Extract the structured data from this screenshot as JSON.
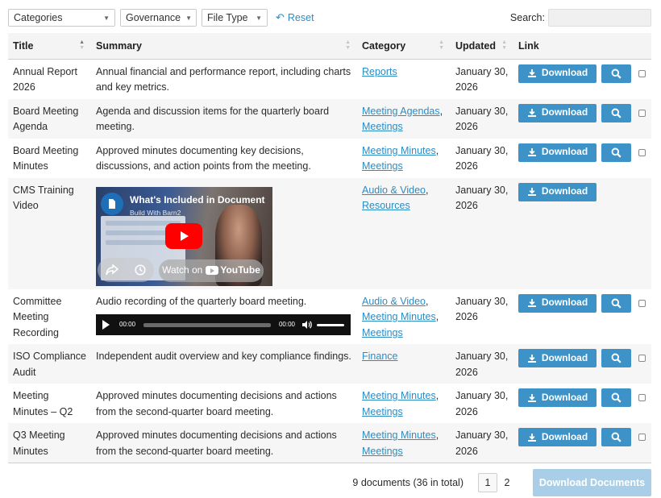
{
  "filters": {
    "categories": "Categories",
    "governance": "Governance",
    "file_type": "File Type",
    "reset": "Reset",
    "search_label": "Search:",
    "search_value": ""
  },
  "table": {
    "headers": {
      "title": "Title",
      "summary": "Summary",
      "category": "Category",
      "updated": "Updated",
      "link": "Link"
    },
    "download_label": "Download",
    "rows": [
      {
        "title": "Annual Report 2026",
        "summary": "Annual financial and performance report, including charts and key metrics.",
        "categories": [
          "Reports"
        ],
        "updated": "January 30, 2026"
      },
      {
        "title": "Board Meeting Agenda",
        "summary": "Agenda and discussion items for the quarterly board meeting.",
        "categories": [
          "Meeting Agendas",
          "Meetings"
        ],
        "updated": "January 30, 2026"
      },
      {
        "title": "Board Meeting Minutes",
        "summary": "Approved minutes documenting key decisions, discussions, and action points from the meeting.",
        "categories": [
          "Meeting Minutes",
          "Meetings"
        ],
        "updated": "January 30, 2026"
      },
      {
        "title": "CMS Training Video",
        "summary": "",
        "categories": [
          "Audio & Video",
          "Resources"
        ],
        "updated": "January 30, 2026"
      },
      {
        "title": "Committee Meeting Recording",
        "summary": "Audio recording of the quarterly board meeting.",
        "categories": [
          "Audio & Video",
          "Meeting Minutes",
          "Meetings"
        ],
        "updated": "January 30, 2026"
      },
      {
        "title": "ISO Compliance Audit",
        "summary": "Independent audit overview and key compliance findings.",
        "categories": [
          "Finance"
        ],
        "updated": "January 30, 2026"
      },
      {
        "title": "Meeting Minutes – Q2",
        "summary": "Approved minutes documenting decisions and actions from the second-quarter board meeting.",
        "categories": [
          "Meeting Minutes",
          "Meetings"
        ],
        "updated": "January 30, 2026"
      },
      {
        "title": "Q3 Meeting Minutes",
        "summary": "Approved minutes documenting decisions and actions from the second-quarter board meeting.",
        "categories": [
          "Meeting Minutes",
          "Meetings"
        ],
        "updated": "January 30, 2026"
      }
    ]
  },
  "video": {
    "title": "What's Included in Document",
    "subtitle": "Build With Barn2",
    "watch_on": "Watch on",
    "youtube": "YouTube"
  },
  "audio": {
    "current": "00:00",
    "duration": "00:00"
  },
  "footer": {
    "count": "9 documents (36 in total)",
    "pages": [
      "1",
      "2"
    ],
    "current_page": "1",
    "download_documents": "Download Documents"
  },
  "colors": {
    "accent": "#3d92c8",
    "link": "#2b8cc4",
    "disabled_button": "#a9cfe8"
  },
  "icons": [
    "undo-icon",
    "download-icon",
    "search-icon",
    "play-icon",
    "share-icon",
    "clock-icon",
    "volume-icon",
    "sort-icon"
  ]
}
